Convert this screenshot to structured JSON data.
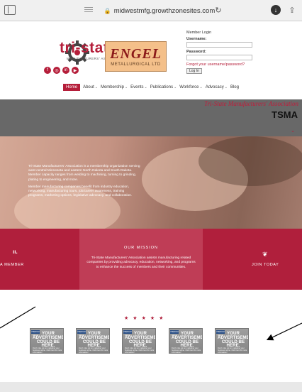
{
  "browser": {
    "url": "midwestmfg.growthzonesites.com"
  },
  "logo": {
    "brand_a": "tri-",
    "brand_b": "state",
    "subtitle": "MANUFACTURERS' ASSOCIATION"
  },
  "social": [
    "f",
    "◎",
    "in",
    "▶"
  ],
  "sponsor": {
    "main": "ENGEL",
    "sub": "METALLURGICAL LTD"
  },
  "login": {
    "title": "Member Login",
    "username_label": "Username:",
    "password_label": "Password:",
    "forgot": "Forgot your username/password?",
    "button": "Log In"
  },
  "nav": [
    {
      "label": "Home",
      "has_menu": false
    },
    {
      "label": "About",
      "has_menu": true
    },
    {
      "label": "Membership",
      "has_menu": true
    },
    {
      "label": "Events",
      "has_menu": true
    },
    {
      "label": "Publications",
      "has_menu": true
    },
    {
      "label": "Workforce",
      "has_menu": true
    },
    {
      "label": "Advocacy",
      "has_menu": true
    },
    {
      "label": "Blog",
      "has_menu": false
    }
  ],
  "banner": {
    "association": "Tri-State Manufacturers' Association",
    "acronym": "TSMA"
  },
  "hero": {
    "p1": "Tri-State Manufacturers' Association is a membership organization serving west central Minnesota and eastern North Dakota and South Dakota. Member capacity ranges from welding to machining, turning to grinding, plating to engineering, and more.",
    "p2": "Member manufacturing companies benefit from industry education, networking, manufacturing tours, job/career awareness, training programs, marketing options, legislative advocacy, and collaboration."
  },
  "band": {
    "member_label": "A MEMBER",
    "mission_title": "OUR MISSION",
    "mission_text": "Tri-State Manufacturers' Association assists manufacturing related companies by providing advocacy, education, networking, and programs to enhance the success of members and their communities.",
    "join_label": "JOIN TODAY"
  },
  "ads": {
    "tag": "PREMIUM SPACE",
    "heading": "YOUR ADVERTISEMENT COULD BE HERE.",
    "body": "Don't miss out on marketing your business online. Click here for more information!"
  },
  "colors": {
    "brand": "#b01f3c",
    "banner": "#686868"
  }
}
